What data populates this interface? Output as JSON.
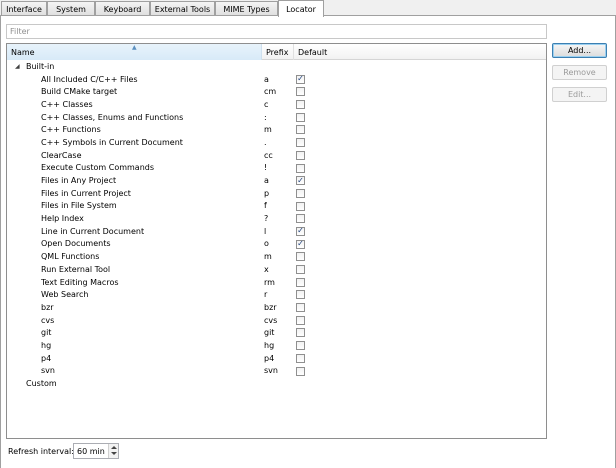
{
  "tabs": [
    {
      "label": "Interface"
    },
    {
      "label": "System"
    },
    {
      "label": "Keyboard"
    },
    {
      "label": "External Tools"
    },
    {
      "label": "MIME Types"
    },
    {
      "label": "Locator",
      "active": true
    }
  ],
  "filter": {
    "placeholder": "Filter"
  },
  "columns": {
    "name": "Name",
    "prefix": "Prefix",
    "default": "Default"
  },
  "tree": {
    "builtin_label": "Built-in",
    "custom_label": "Custom",
    "items": [
      {
        "name": "All Included C/C++ Files",
        "prefix": "a",
        "default": true
      },
      {
        "name": "Build CMake target",
        "prefix": "cm",
        "default": false
      },
      {
        "name": "C++ Classes",
        "prefix": "c",
        "default": false
      },
      {
        "name": "C++ Classes, Enums and Functions",
        "prefix": ":",
        "default": false
      },
      {
        "name": "C++ Functions",
        "prefix": "m",
        "default": false
      },
      {
        "name": "C++ Symbols in Current Document",
        "prefix": ".",
        "default": false
      },
      {
        "name": "ClearCase",
        "prefix": "cc",
        "default": false
      },
      {
        "name": "Execute Custom Commands",
        "prefix": "!",
        "default": false
      },
      {
        "name": "Files in Any Project",
        "prefix": "a",
        "default": true
      },
      {
        "name": "Files in Current Project",
        "prefix": "p",
        "default": false
      },
      {
        "name": "Files in File System",
        "prefix": "f",
        "default": false
      },
      {
        "name": "Help Index",
        "prefix": "?",
        "default": false
      },
      {
        "name": "Line in Current Document",
        "prefix": "l",
        "default": true
      },
      {
        "name": "Open Documents",
        "prefix": "o",
        "default": true
      },
      {
        "name": "QML Functions",
        "prefix": "m",
        "default": false
      },
      {
        "name": "Run External Tool",
        "prefix": "x",
        "default": false
      },
      {
        "name": "Text Editing Macros",
        "prefix": "rm",
        "default": false
      },
      {
        "name": "Web Search",
        "prefix": "r",
        "default": false
      },
      {
        "name": "bzr",
        "prefix": "bzr",
        "default": false
      },
      {
        "name": "cvs",
        "prefix": "cvs",
        "default": false
      },
      {
        "name": "git",
        "prefix": "git",
        "default": false
      },
      {
        "name": "hg",
        "prefix": "hg",
        "default": false
      },
      {
        "name": "p4",
        "prefix": "p4",
        "default": false
      },
      {
        "name": "svn",
        "prefix": "svn",
        "default": false
      }
    ]
  },
  "buttons": {
    "add": "Add...",
    "remove": "Remove",
    "edit": "Edit..."
  },
  "refresh": {
    "label": "Refresh interval:",
    "value": "60 min"
  }
}
